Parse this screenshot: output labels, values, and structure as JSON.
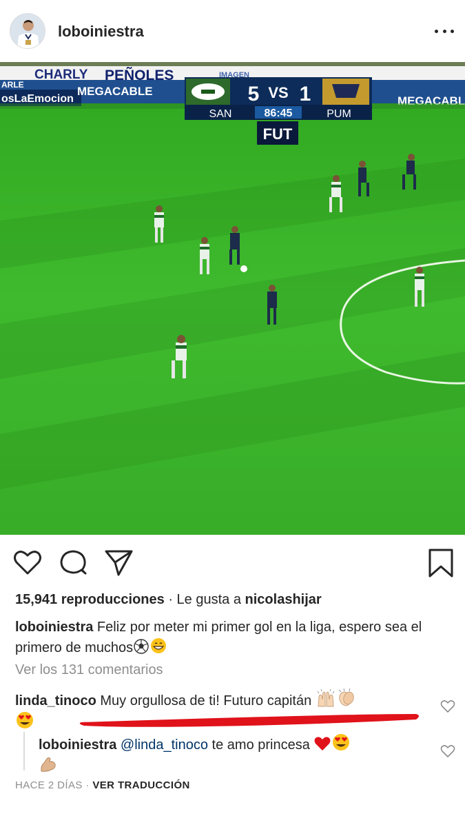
{
  "header": {
    "username": "loboiniestra"
  },
  "video": {
    "boards": [
      "CHARLY",
      "PEÑOLES",
      "MEGACABLE",
      "MEGACABLE",
      "IMAGEN"
    ],
    "hashtag": "osLaEmocion",
    "left_board_top": "ARLE",
    "score": {
      "home_score": "5",
      "vs": "VS",
      "away_score": "1",
      "home": "SAN",
      "clock": "86:45",
      "away": "PUM"
    },
    "channel": "FUT"
  },
  "stats": {
    "views": "15,941 reproducciones",
    "separator": " · Le gusta a ",
    "liked_by": "nicolashijar"
  },
  "caption": {
    "username": "loboiniestra",
    "text": "Feliz por meter mi primer gol en la liga, espero sea el primero de muchos"
  },
  "view_comments": "Ver los 131 comentarios",
  "comments": [
    {
      "username": "linda_tinoco",
      "text": "Muy orgullosa de ti! Futuro capitán"
    },
    {
      "username": "loboiniestra",
      "mention": "@linda_tinoco",
      "text": "te amo princesa"
    }
  ],
  "footer": {
    "time": "HACE 2 DÍAS",
    "dot": "·",
    "translate": "VER TRADUCCIÓN"
  },
  "colors": {
    "pitch": "#3db52b",
    "pitch_dark": "#34a525",
    "mention": "#003569",
    "annotation": "#e0121a",
    "text": "#262626",
    "muted": "#8e8e8e"
  }
}
